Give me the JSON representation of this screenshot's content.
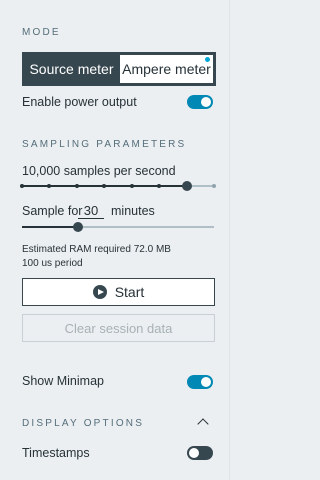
{
  "mode": {
    "section_title": "MODE",
    "options": [
      "Source meter",
      "Ampere meter"
    ],
    "selected": "Ampere meter"
  },
  "power_output": {
    "label": "Enable power output",
    "enabled": true
  },
  "sampling": {
    "section_title": "SAMPLING PARAMETERS",
    "rate_label": "10,000 samples per second",
    "rate_steps_total": 8,
    "rate_selected_step": 6,
    "duration_prefix": "Sample for",
    "duration_value": "30",
    "duration_unit": "minutes",
    "duration_fraction": 0.29,
    "ram_text": "Estimated RAM required 72.0 MB",
    "period_text": "100 us period"
  },
  "actions": {
    "start_label": "Start",
    "clear_label": "Clear session data"
  },
  "minimap": {
    "label": "Show Minimap",
    "enabled": true
  },
  "display": {
    "section_title": "DISPLAY OPTIONS",
    "timestamps_label": "Timestamps",
    "timestamps_enabled": false
  },
  "colors": {
    "accent": "#0288b5",
    "dark": "#37474f",
    "background": "#eceff1"
  }
}
